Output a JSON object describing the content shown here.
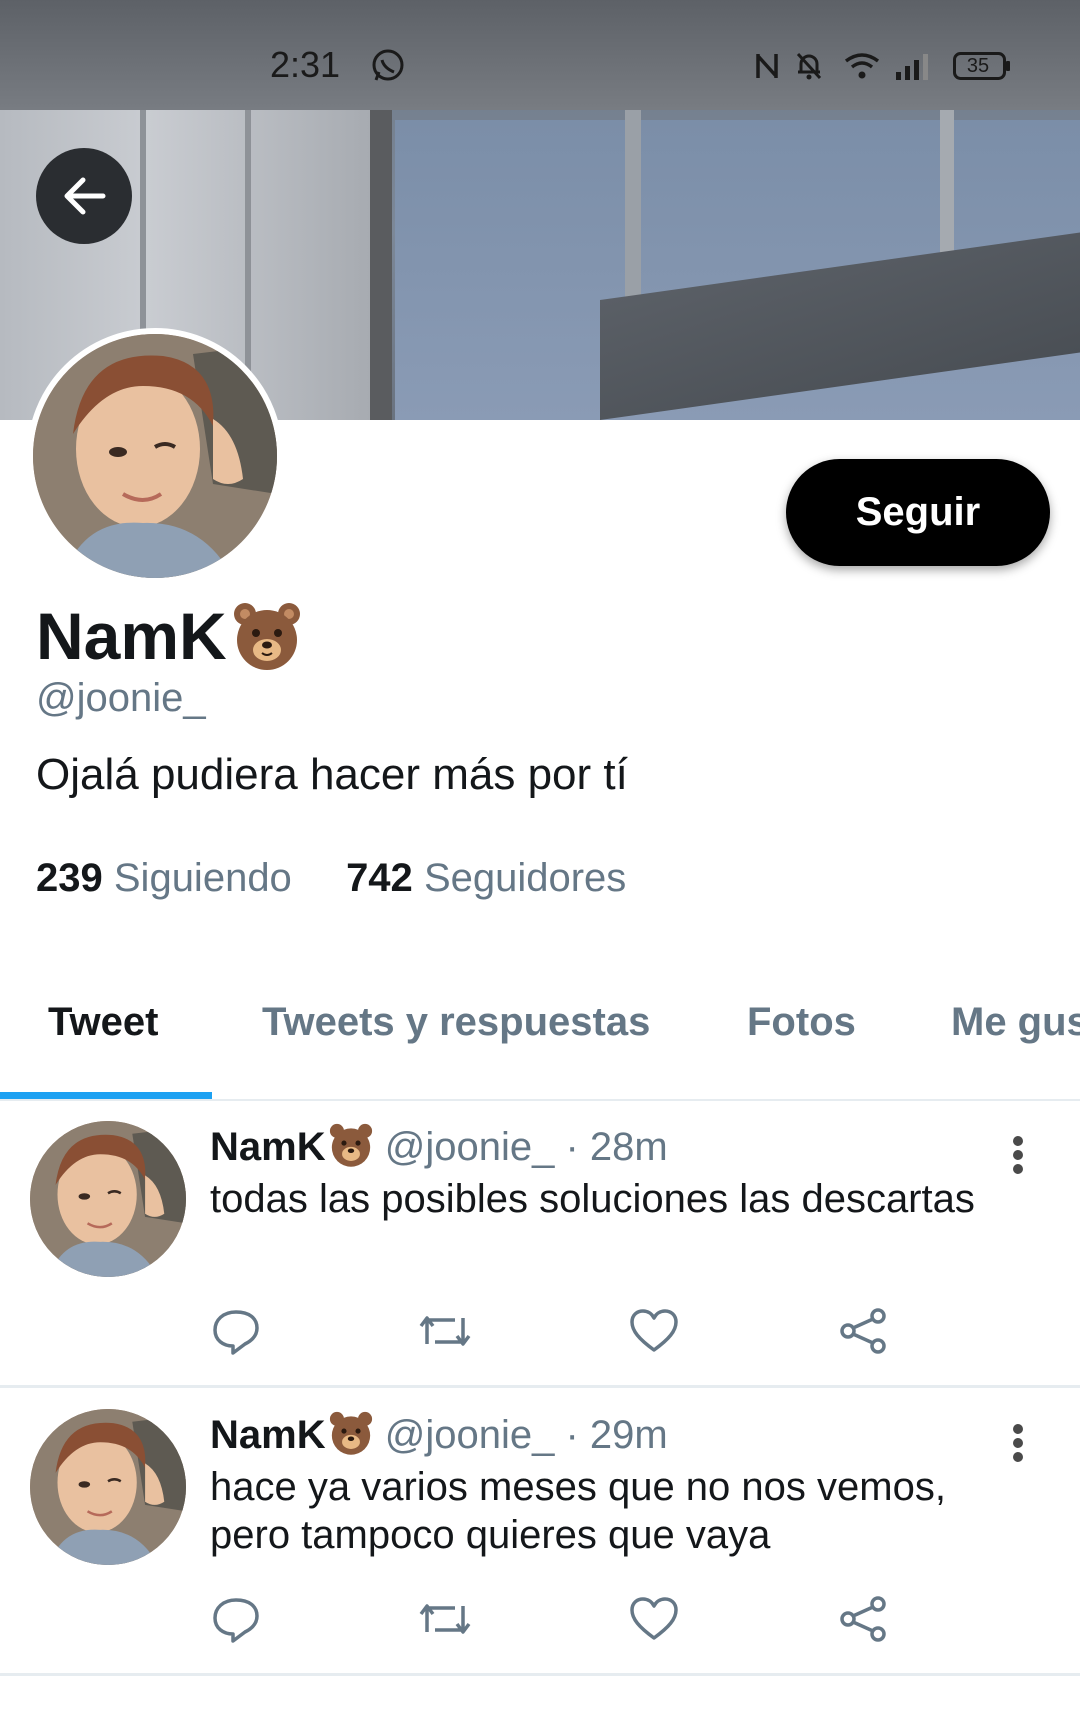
{
  "status_bar": {
    "time": "2:31",
    "battery": "35",
    "icons": [
      "whatsapp-icon",
      "nfc-icon",
      "bell-off-icon",
      "wifi-icon",
      "signal-icon",
      "battery-icon"
    ]
  },
  "profile": {
    "display_name": "NamK",
    "name_emoji": "bear-face-emoji",
    "handle": "@joonie_",
    "bio": "Ojalá pudiera hacer más por tí",
    "following_count": "239",
    "following_label": "Siguiendo",
    "followers_count": "742",
    "followers_label": "Seguidores",
    "follow_button": "Seguir"
  },
  "tabs": [
    "Tweet",
    "Tweets y respuestas",
    "Fotos",
    "Me gus"
  ],
  "tweets": [
    {
      "name": "NamK",
      "handle": "@joonie_",
      "separator": "·",
      "time": "28m",
      "text": "todas las posibles soluciones las descartas"
    },
    {
      "name": "NamK",
      "handle": "@joonie_",
      "separator": "·",
      "time": "29m",
      "text": "hace ya varios meses que no nos vemos, pero tampoco quieres que vaya"
    }
  ],
  "colors": {
    "accent": "#1da1f2",
    "secondary_text": "#657786",
    "primary_text": "#14171a",
    "follow_button_bg": "#000000"
  }
}
